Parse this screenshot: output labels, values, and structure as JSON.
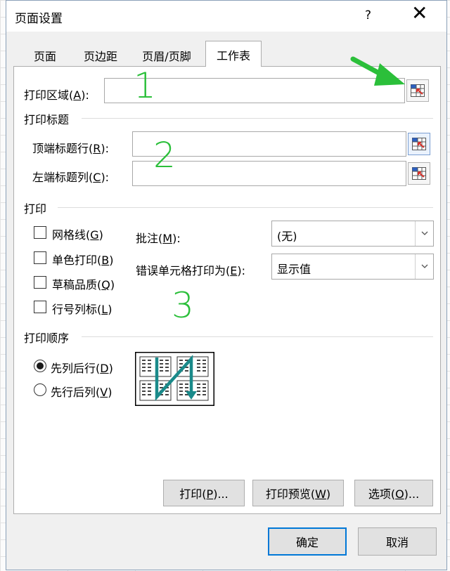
{
  "window": {
    "title": "页面设置",
    "help": "?",
    "close": "✕"
  },
  "tabs": [
    {
      "label": "页面",
      "active": false
    },
    {
      "label": "页边距",
      "active": false
    },
    {
      "label": "页眉/页脚",
      "active": false
    },
    {
      "label": "工作表",
      "active": true
    }
  ],
  "print_area": {
    "label": "打印区域",
    "key": "A",
    "value": ""
  },
  "print_titles": {
    "heading": "打印标题",
    "top_row": {
      "label": "顶端标题行",
      "key": "R",
      "value": ""
    },
    "left_col": {
      "label": "左端标题列",
      "key": "C",
      "value": ""
    }
  },
  "print": {
    "heading": "打印",
    "checkboxes": [
      {
        "label": "网格线",
        "key": "G",
        "checked": false
      },
      {
        "label": "单色打印",
        "key": "B",
        "checked": false
      },
      {
        "label": "草稿品质",
        "key": "Q",
        "checked": false
      },
      {
        "label": "行号列标",
        "key": "L",
        "checked": false
      }
    ],
    "comments": {
      "label": "批注",
      "key": "M",
      "value": "(无)"
    },
    "cell_errors": {
      "label": "错误单元格打印为",
      "key": "E",
      "value": "显示值"
    }
  },
  "page_order": {
    "heading": "打印顺序",
    "options": [
      {
        "label": "先列后行",
        "key": "D",
        "selected": true
      },
      {
        "label": "先行后列",
        "key": "V",
        "selected": false
      }
    ]
  },
  "buttons": {
    "print": {
      "label": "打印",
      "key": "P",
      "suffix": "..."
    },
    "preview": {
      "label": "打印预览",
      "key": "W",
      "suffix": ""
    },
    "options": {
      "label": "选项",
      "key": "O",
      "suffix": "..."
    },
    "ok": "确定",
    "cancel": "取消"
  },
  "annotations": [
    "1",
    "2",
    "3"
  ],
  "colors": {
    "annotation_green": "#2bbf3a",
    "order_arrow": "#1a8a8a",
    "accent_blue": "#0078d7"
  },
  "icons": {
    "range_picker": "collapse-dialog-icon",
    "dropdown": "chevron-down-icon"
  }
}
